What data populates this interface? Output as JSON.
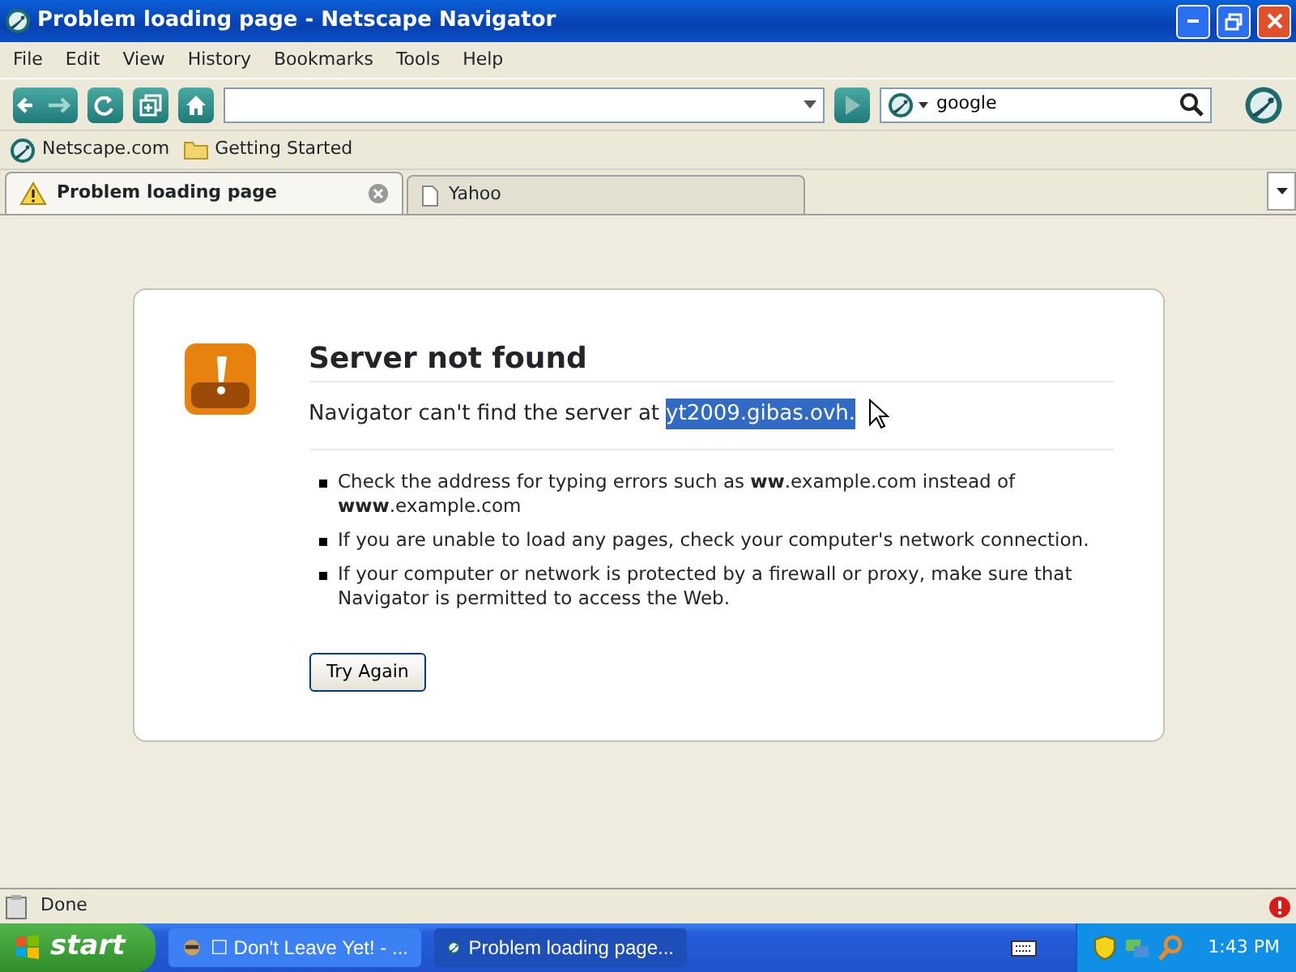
{
  "window": {
    "title": "Problem loading page - Netscape Navigator"
  },
  "menu": [
    "File",
    "Edit",
    "View",
    "History",
    "Bookmarks",
    "Tools",
    "Help"
  ],
  "search": {
    "value": "google"
  },
  "bookmarks": [
    {
      "label": "Netscape.com",
      "kind": "site"
    },
    {
      "label": "Getting Started",
      "kind": "folder"
    }
  ],
  "tabs": [
    {
      "label": "Problem loading page",
      "kind": "warning",
      "selected": true
    },
    {
      "label": "Yahoo",
      "kind": "page",
      "selected": false
    }
  ],
  "error": {
    "title": "Server not found",
    "message": "Navigator can't find the server at",
    "selection": "yt2009.gibas.ovh.",
    "bullets": [
      "Check the address for typing errors such as **ww**.example.com instead of **www**.example.com",
      "If you are unable to load any pages, check your computer's network connection.",
      "If your computer or network is protected by a firewall or proxy, make sure that Navigator is permitted to access the Web."
    ],
    "button": "Try Again"
  },
  "status_bar": {
    "text": "Done"
  },
  "taskbar": {
    "start": "start",
    "tasks": [
      {
        "label": "☐ Don't Leave Yet! - ...",
        "selected": false
      },
      {
        "label": "Problem loading page...",
        "selected": true
      }
    ],
    "clock": "1:43 PM"
  }
}
